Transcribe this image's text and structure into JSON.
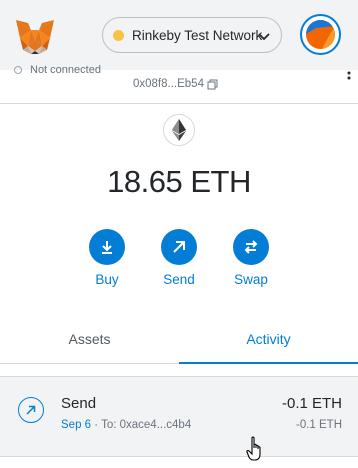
{
  "header": {
    "network": "Rinkeby Test Network",
    "network_color": "#f6c343",
    "accent": "#037dd6"
  },
  "account": {
    "connection_status": "Not connected",
    "address": "0x08f8...Eb54"
  },
  "balance": {
    "amount": "18.65 ETH"
  },
  "actions": [
    {
      "label": "Buy",
      "icon": "download-icon"
    },
    {
      "label": "Send",
      "icon": "arrow-up-right-icon"
    },
    {
      "label": "Swap",
      "icon": "swap-arrows-icon"
    }
  ],
  "tabs": [
    {
      "label": "Assets",
      "active": false
    },
    {
      "label": "Activity",
      "active": true
    }
  ],
  "activity": [
    {
      "title": "Send",
      "date": "Sep 6",
      "detail": " · To: 0xace4...c4b4",
      "amount": "-0.1 ETH",
      "amount_secondary": "-0.1 ETH",
      "icon": "arrow-up-right-icon"
    }
  ]
}
